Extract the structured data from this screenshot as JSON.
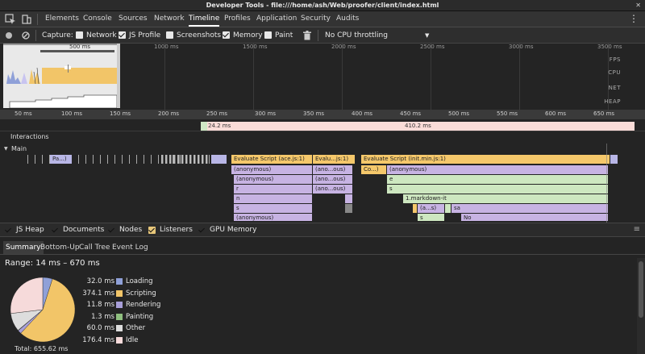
{
  "window": {
    "title": "Developer Tools - file:///home/ash/Web/proofer/client/index.html",
    "close": "✕"
  },
  "tabs": [
    "Elements",
    "Console",
    "Sources",
    "Network",
    "Timeline",
    "Profiles",
    "Application",
    "Security",
    "Audits"
  ],
  "active_tab": "Timeline",
  "toolbar": {
    "capture_label": "Capture:",
    "checkboxes": [
      {
        "label": "Network",
        "checked": false
      },
      {
        "label": "JS Profile",
        "checked": true
      },
      {
        "label": "Screenshots",
        "checked": false
      },
      {
        "label": "Memory",
        "checked": true
      },
      {
        "label": "Paint",
        "checked": false
      }
    ],
    "throttling": "No CPU throttling",
    "dropdown_arrow": "▼"
  },
  "overview": {
    "selection_label": "500 ms",
    "ticks": [
      "1000 ms",
      "1500 ms",
      "2000 ms",
      "2500 ms",
      "3000 ms",
      "3500 ms"
    ],
    "rows": [
      "FPS",
      "CPU",
      "NET",
      "HEAP"
    ]
  },
  "ruler": [
    "50 ms",
    "100 ms",
    "150 ms",
    "200 ms",
    "250 ms",
    "300 ms",
    "350 ms",
    "400 ms",
    "450 ms",
    "500 ms",
    "550 ms",
    "600 ms",
    "650 ms"
  ],
  "frames": {
    "first": "24.2 ms",
    "second": "410.2 ms"
  },
  "interactions_label": "Interactions",
  "main_label": "Main",
  "flame": {
    "pa": "Pa...)",
    "eval1": "Evaluate Script (ace.js:1)",
    "eval2": "Evalu...js:1)",
    "eval3": "Evaluate Script (init.min.js:1)",
    "anon": "(anonymous)",
    "anon_short": "(ano...ous)",
    "co": "Co...)",
    "r": "r",
    "n": "n",
    "s": "s",
    "e": "e",
    "markdown": "1.markdown-it",
    "a_s": "(a...s)",
    "sa": "sa",
    "no": "No"
  },
  "counters": [
    {
      "label": "JS Heap",
      "checked": true
    },
    {
      "label": "Documents",
      "checked": true
    },
    {
      "label": "Nodes",
      "checked": true
    },
    {
      "label": "Listeners",
      "checked": true
    },
    {
      "label": "GPU Memory",
      "checked": true
    }
  ],
  "subtabs": [
    "Summary",
    "Bottom-Up",
    "Call Tree",
    "Event Log"
  ],
  "active_subtab": "Summary",
  "summary": {
    "range": "Range: 14 ms – 670 ms",
    "total": "Total: 655.62 ms",
    "legend": [
      {
        "value": "32.0 ms",
        "label": "Loading",
        "color": "#8fa0d8",
        "ms": 32.0
      },
      {
        "value": "374.1 ms",
        "label": "Scripting",
        "color": "#f2c568",
        "ms": 374.1
      },
      {
        "value": "11.8 ms",
        "label": "Rendering",
        "color": "#a89fd8",
        "ms": 11.8
      },
      {
        "value": "1.3 ms",
        "label": "Painting",
        "color": "#8fbf7f",
        "ms": 1.3
      },
      {
        "value": "60.0 ms",
        "label": "Other",
        "color": "#dddddd",
        "ms": 60.0
      },
      {
        "value": "176.4 ms",
        "label": "Idle",
        "color": "#f6dada",
        "ms": 176.4
      }
    ]
  }
}
